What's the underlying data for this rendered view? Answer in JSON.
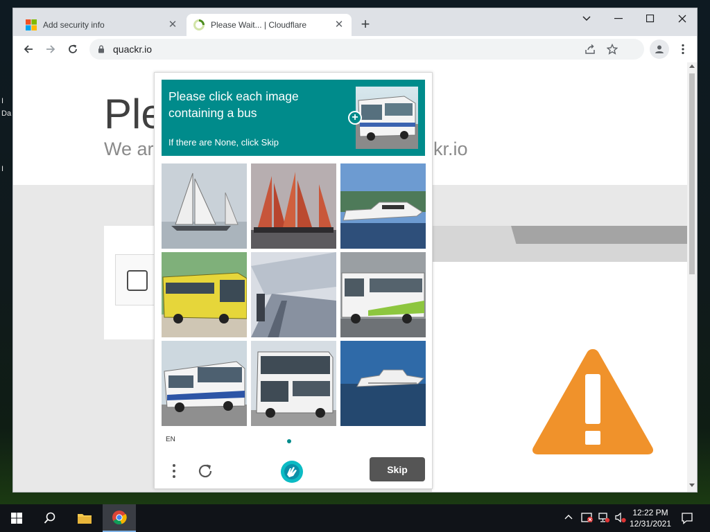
{
  "desktop": {
    "labels": [
      "I",
      "Da",
      "I"
    ]
  },
  "browser": {
    "tabs": [
      {
        "title": "Add security info",
        "active": false
      },
      {
        "title": "Please Wait... | Cloudflare",
        "active": true
      }
    ],
    "url": "quackr.io"
  },
  "page": {
    "heading": "Ple",
    "subtitle_left": "We ar",
    "subtitle_right": "kr.io"
  },
  "captcha": {
    "prompt": "Please click each image containing a bus",
    "hint": "If there are None, click Skip",
    "language": "EN",
    "skip_label": "Skip",
    "grid": [
      {
        "subject": "sailboat"
      },
      {
        "subject": "sailing-ship"
      },
      {
        "subject": "motor-yacht"
      },
      {
        "subject": "yellow-bus"
      },
      {
        "subject": "train-platform"
      },
      {
        "subject": "white-green-bus"
      },
      {
        "subject": "white-blue-bus"
      },
      {
        "subject": "double-decker-bus"
      },
      {
        "subject": "ferry"
      }
    ]
  },
  "taskbar": {
    "time": "12:22 PM",
    "date": "12/31/2021"
  },
  "colors": {
    "captcha_accent": "#008b8b",
    "warning": "#f0922b",
    "skip_button": "#555555"
  }
}
